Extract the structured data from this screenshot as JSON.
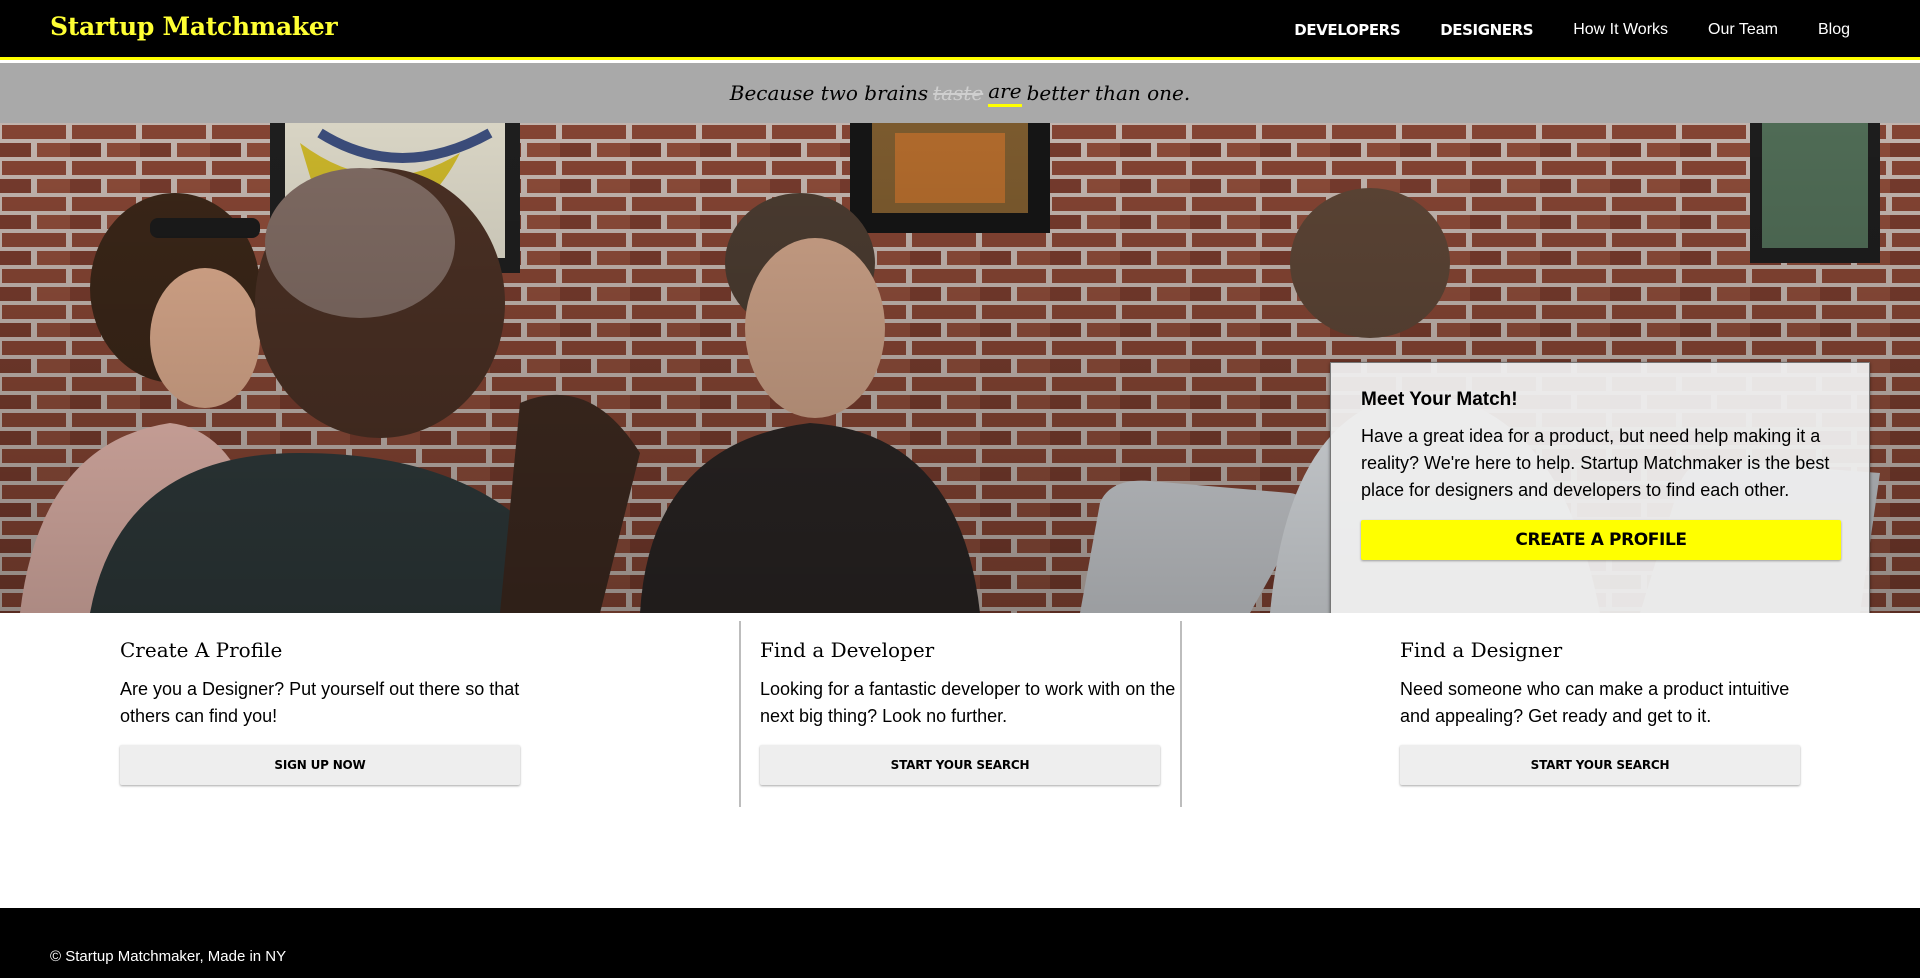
{
  "header": {
    "brand": "Startup Matchmaker",
    "nav": [
      {
        "label": "DEVELOPERS"
      },
      {
        "label": "DESIGNERS"
      },
      {
        "label": "How It Works"
      },
      {
        "label": "Our Team"
      },
      {
        "label": "Blog"
      }
    ],
    "accent_color": "#ffff00"
  },
  "tagline": {
    "before": "Because two brains",
    "struck": "taste",
    "highlight": "are",
    "after": "better than one."
  },
  "hero": {
    "card": {
      "title": "Meet Your Match!",
      "body": "Have a great idea for a product, but need help making it a reality? We're here to help. Startup Matchmaker is the best place for designers and developers to find each other.",
      "button": "CREATE A PROFILE"
    }
  },
  "features": [
    {
      "title": "Create A Profile",
      "body": "Are you a Designer? Put yourself out there so that others can find you!",
      "button": "SIGN UP NOW"
    },
    {
      "title": "Find a Developer",
      "body": "Looking for a fantastic developer to work with on the next big thing? Look no further.",
      "button": "START YOUR SEARCH"
    },
    {
      "title": "Find a Designer",
      "body": "Need someone who can make a product intuitive and appealing? Get ready and get to it.",
      "button": "START YOUR SEARCH"
    }
  ],
  "footer": {
    "text": "© Startup Matchmaker, Made in NY"
  }
}
